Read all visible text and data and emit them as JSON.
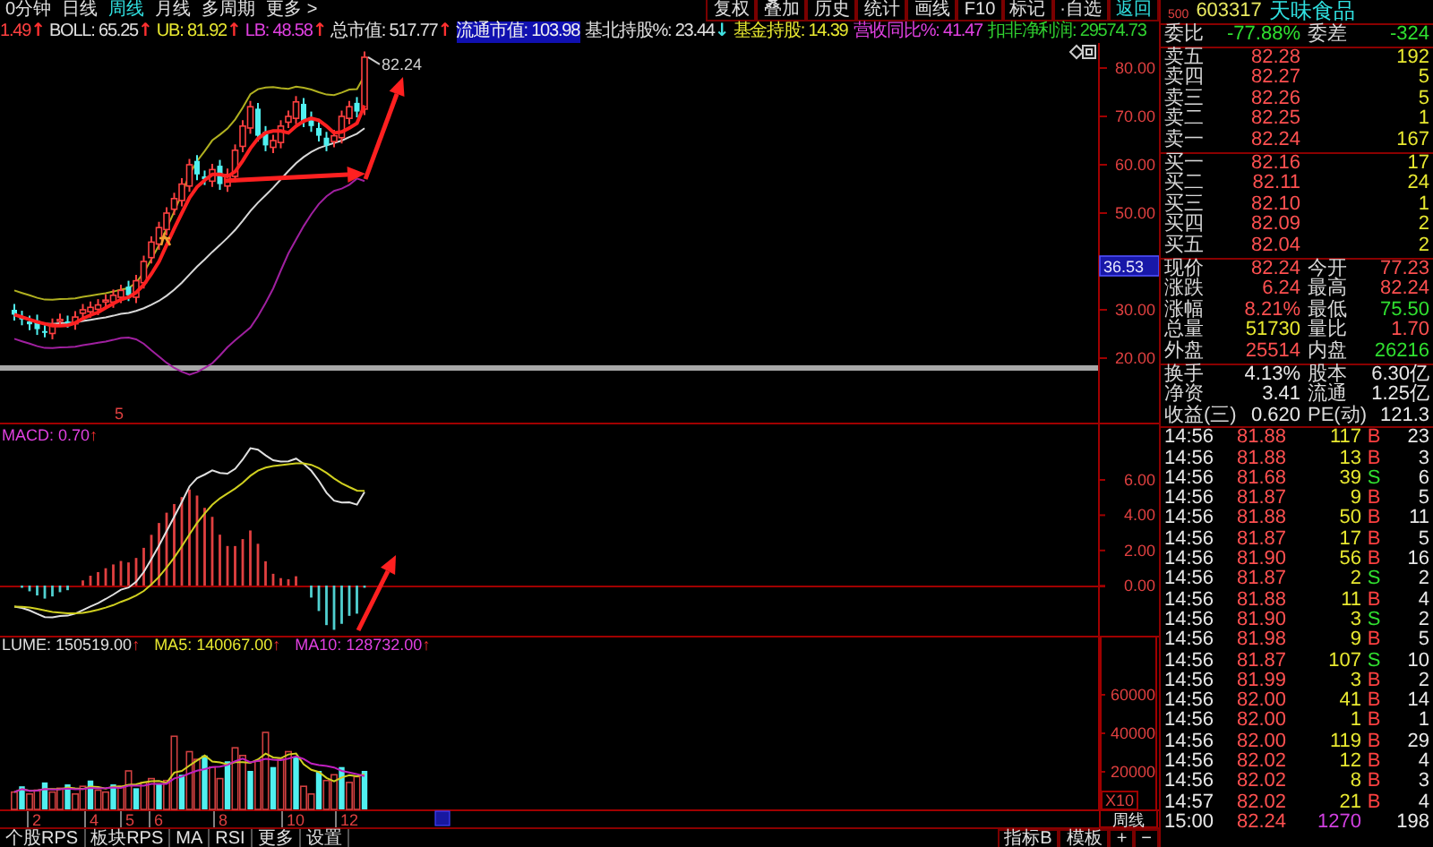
{
  "toolbar": {
    "tabs": [
      {
        "label": "0分钟",
        "selected": false
      },
      {
        "label": "日线",
        "selected": false
      },
      {
        "label": "周线",
        "selected": true
      },
      {
        "label": "月线",
        "selected": false
      },
      {
        "label": "多周期",
        "selected": false
      },
      {
        "label": "更多 >",
        "selected": false
      }
    ],
    "buttons": [
      "复权",
      "叠加",
      "历史",
      "统计",
      "画线",
      "F10"
    ],
    "side_buttons": [
      {
        "label": "标记",
        "highlighted": false
      },
      {
        "label": "·自选",
        "highlighted": false
      },
      {
        "label": "返回",
        "highlighted": true
      }
    ]
  },
  "indicators": [
    {
      "text": "1.49",
      "color": "#ff4040",
      "mark": {
        "text": "↑",
        "color": "#ff3030"
      }
    },
    {
      "text": "BOLL: 65.25",
      "color": "#e0e0e0",
      "mark": {
        "text": "↑",
        "color": "#ff3030"
      }
    },
    {
      "text": "UB: 81.92",
      "color": "#e8e830",
      "mark": {
        "text": "↑",
        "color": "#ff3030"
      }
    },
    {
      "text": "LB: 48.58",
      "color": "#e040e0",
      "mark": {
        "text": "↑",
        "color": "#ff3030"
      }
    },
    {
      "text": "总市值: 517.77",
      "color": "#e0e0e0",
      "mark": {
        "text": "↑",
        "color": "#ff3030"
      }
    },
    {
      "text": "流通市值: 103.98",
      "highlighted": true
    },
    {
      "text": "基北持股%: 23.44",
      "color": "#e0e0e0",
      "mark": {
        "text": "↓",
        "color": "#40e0e0"
      }
    },
    {
      "text": "基金持股: 14.39",
      "color": "#e8e830"
    },
    {
      "text": "营收同比%: 41.47",
      "color": "#e040e0"
    },
    {
      "text": "扣非净利润: 29574.73",
      "color": "#30d030"
    }
  ],
  "price_chart": {
    "last_price": "82.24",
    "axis_labels": [
      "80.00",
      "70.00",
      "60.00",
      "50.00",
      "30.00",
      "20.00"
    ],
    "cursor_value": "36.53",
    "event_marker": "5"
  },
  "macd": {
    "label": "MACD: 0.70",
    "mark": "↑",
    "axis_labels": [
      "6.00",
      "4.00",
      "2.00",
      "0.00"
    ]
  },
  "volume": {
    "legend": [
      {
        "text": "LUME: 150519.00",
        "color": "#e0e0e0",
        "mark": "↑"
      },
      {
        "text": "MA5: 140067.00",
        "color": "#e8e830",
        "mark": "↑"
      },
      {
        "text": "MA10: 128732.00",
        "color": "#e040e0",
        "mark": "↑"
      }
    ],
    "axis_labels": [
      "60000",
      "40000",
      "20000"
    ],
    "scale": "X10"
  },
  "x_axis": {
    "labels": [
      "2",
      "4",
      "5",
      "6",
      "8",
      "10",
      "12"
    ],
    "period_button": "周线"
  },
  "bottom_bar": {
    "tabs": [
      "个股RPS",
      "板块RPS",
      "MA",
      "RSI",
      "更多",
      "设置"
    ],
    "buttons": [
      "指标B",
      "模板",
      "+",
      "−"
    ]
  },
  "quote": {
    "badge": "500",
    "code": "603317",
    "name": "天味食品",
    "ratio": [
      {
        "label": "委比",
        "value": "-77.88%",
        "kind": "down"
      },
      {
        "label": "委差",
        "value": "-324",
        "kind": "down"
      }
    ],
    "asks": [
      {
        "label": "卖五",
        "price": "82.28",
        "volume": "192"
      },
      {
        "label": "卖四",
        "price": "82.27",
        "volume": "5"
      },
      {
        "label": "卖三",
        "price": "82.26",
        "volume": "5"
      },
      {
        "label": "卖二",
        "price": "82.25",
        "volume": "1"
      },
      {
        "label": "卖一",
        "price": "82.24",
        "volume": "167"
      }
    ],
    "bids": [
      {
        "label": "买一",
        "price": "82.16",
        "volume": "17"
      },
      {
        "label": "买二",
        "price": "82.11",
        "volume": "24"
      },
      {
        "label": "买三",
        "price": "82.10",
        "volume": "1"
      },
      {
        "label": "买四",
        "price": "82.09",
        "volume": "2"
      },
      {
        "label": "买五",
        "price": "82.04",
        "volume": "2"
      }
    ],
    "stats": [
      [
        {
          "label": "现价",
          "value": "82.24",
          "color": "#ff5050"
        },
        {
          "label": "今开",
          "value": "77.23",
          "color": "#ff5050"
        }
      ],
      [
        {
          "label": "涨跌",
          "value": "6.24",
          "color": "#ff5050"
        },
        {
          "label": "最高",
          "value": "82.24",
          "color": "#ff5050"
        }
      ],
      [
        {
          "label": "涨幅",
          "value": "8.21%",
          "color": "#ff5050"
        },
        {
          "label": "最低",
          "value": "75.50",
          "color": "#30e030"
        }
      ],
      [
        {
          "label": "总量",
          "value": "51730",
          "color": "#e8e830"
        },
        {
          "label": "量比",
          "value": "1.70",
          "color": "#ff5050"
        }
      ],
      [
        {
          "label": "外盘",
          "value": "25514",
          "color": "#ff5050"
        },
        {
          "label": "内盘",
          "value": "26216",
          "color": "#30e030"
        }
      ]
    ],
    "capital": [
      {
        "label": "换手",
        "value": "4.13%",
        "label2": "股本",
        "value2": "6.30亿"
      },
      {
        "label": "净资",
        "value": "3.41",
        "label2": "流通",
        "value2": "1.25亿"
      },
      {
        "label": "收益(三)",
        "value": "0.620",
        "label2": "PE(动)",
        "value2": "121.3"
      }
    ]
  },
  "trades": [
    {
      "time": "14:56",
      "price": "81.88",
      "volume": "117",
      "side": "B",
      "count": "23",
      "kind": "buy"
    },
    {
      "time": "14:56",
      "price": "81.88",
      "volume": "13",
      "side": "B",
      "count": "3",
      "kind": "buy"
    },
    {
      "time": "14:56",
      "price": "81.68",
      "volume": "39",
      "side": "S",
      "count": "6",
      "kind": "sell"
    },
    {
      "time": "14:56",
      "price": "81.87",
      "volume": "9",
      "side": "B",
      "count": "5",
      "kind": "buy"
    },
    {
      "time": "14:56",
      "price": "81.88",
      "volume": "50",
      "side": "B",
      "count": "11",
      "kind": "buy"
    },
    {
      "time": "14:56",
      "price": "81.87",
      "volume": "17",
      "side": "B",
      "count": "5",
      "kind": "buy"
    },
    {
      "time": "14:56",
      "price": "81.90",
      "volume": "56",
      "side": "B",
      "count": "16",
      "kind": "buy"
    },
    {
      "time": "14:56",
      "price": "81.87",
      "volume": "2",
      "side": "S",
      "count": "2",
      "kind": "sell"
    },
    {
      "time": "14:56",
      "price": "81.88",
      "volume": "11",
      "side": "B",
      "count": "4",
      "kind": "buy"
    },
    {
      "time": "14:56",
      "price": "81.90",
      "volume": "3",
      "side": "S",
      "count": "2",
      "kind": "sell"
    },
    {
      "time": "14:56",
      "price": "81.98",
      "volume": "9",
      "side": "B",
      "count": "5",
      "kind": "buy"
    },
    {
      "time": "14:56",
      "price": "81.87",
      "volume": "107",
      "side": "S",
      "count": "10",
      "kind": "sell"
    },
    {
      "time": "14:56",
      "price": "81.99",
      "volume": "3",
      "side": "B",
      "count": "2",
      "kind": "buy"
    },
    {
      "time": "14:56",
      "price": "82.00",
      "volume": "41",
      "side": "B",
      "count": "14",
      "kind": "buy"
    },
    {
      "time": "14:56",
      "price": "82.00",
      "volume": "1",
      "side": "B",
      "count": "1",
      "kind": "buy"
    },
    {
      "time": "14:56",
      "price": "82.00",
      "volume": "119",
      "side": "B",
      "count": "29",
      "kind": "buy"
    },
    {
      "time": "14:56",
      "price": "82.02",
      "volume": "12",
      "side": "B",
      "count": "4",
      "kind": "buy"
    },
    {
      "time": "14:56",
      "price": "82.02",
      "volume": "8",
      "side": "B",
      "count": "3",
      "kind": "buy"
    },
    {
      "time": "14:57",
      "price": "82.02",
      "volume": "21",
      "side": "B",
      "count": "4",
      "kind": "buy"
    },
    {
      "time": "15:00",
      "price": "82.24",
      "volume": "1270",
      "count": "198",
      "kind": "close"
    }
  ]
}
